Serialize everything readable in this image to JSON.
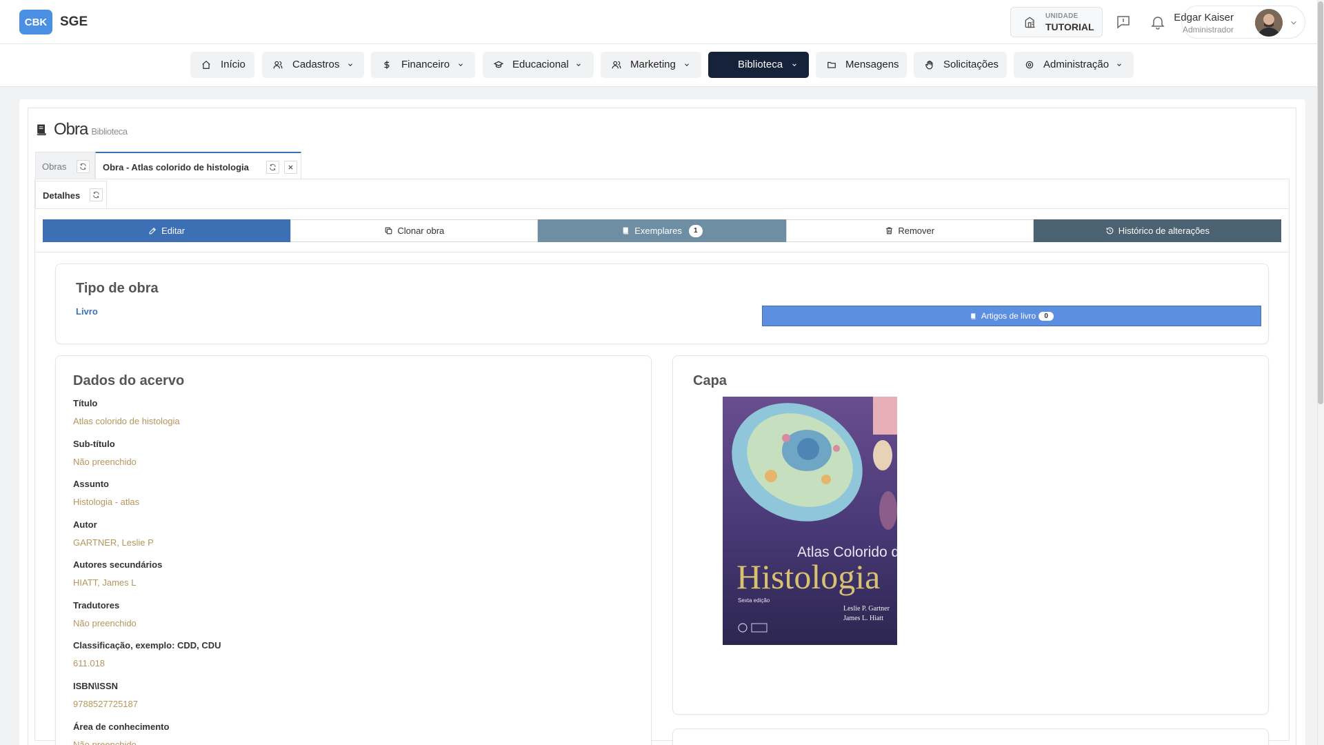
{
  "brand": {
    "logo_text": "CBK",
    "app_name": "SGE"
  },
  "header": {
    "unit_label": "UNIDADE",
    "unit_value": "TUTORIAL",
    "user_name": "Edgar Kaiser",
    "user_role": "Administrador"
  },
  "nav": [
    {
      "label": "Início",
      "icon": "home-icon",
      "dropdown": false
    },
    {
      "label": "Cadastros",
      "icon": "users-icon",
      "dropdown": true
    },
    {
      "label": "Financeiro",
      "icon": "dollar-icon",
      "dropdown": true
    },
    {
      "label": "Educacional",
      "icon": "graduation-cap-icon",
      "dropdown": true
    },
    {
      "label": "Marketing",
      "icon": "users-icon",
      "dropdown": true
    },
    {
      "label": "Biblioteca",
      "icon": "book-icon",
      "dropdown": true,
      "active": true
    },
    {
      "label": "Mensagens",
      "icon": "folder-icon",
      "dropdown": false
    },
    {
      "label": "Solicitações",
      "icon": "hand-icon",
      "dropdown": false
    },
    {
      "label": "Administração",
      "icon": "settings-icon",
      "dropdown": true
    }
  ],
  "page": {
    "title": "Obra",
    "subtitle": "Biblioteca"
  },
  "tabs": [
    {
      "label": "Obras",
      "active": false
    },
    {
      "label": "Obra - Atlas colorido de histologia",
      "active": true
    }
  ],
  "subtab": {
    "label": "Detalhes"
  },
  "actions": {
    "edit": "Editar",
    "clone": "Clonar obra",
    "exemplares": "Exemplares",
    "exemplares_count": "1",
    "remove": "Remover",
    "history": "Histórico de alterações"
  },
  "tipo": {
    "title": "Tipo de obra",
    "value": "Livro",
    "artigos_label": "Artigos de livro",
    "artigos_count": "0"
  },
  "acervo": {
    "title": "Dados do acervo",
    "fields": [
      {
        "label": "Título",
        "value": "Atlas colorido de histologia"
      },
      {
        "label": "Sub-título",
        "value": "Não preenchido"
      },
      {
        "label": "Assunto",
        "value": "Histologia - atlas"
      },
      {
        "label": "Autor",
        "value": "GARTNER, Leslie P"
      },
      {
        "label": "Autores secundários",
        "value": "HIATT, James L"
      },
      {
        "label": "Tradutores",
        "value": "Não preenchido"
      },
      {
        "label": "Classificação, exemplo: CDD, CDU",
        "value": "611.018"
      },
      {
        "label": "ISBN\\ISSN",
        "value": "9788527725187"
      },
      {
        "label": "Área de conhecimento",
        "value": "Não preenchido"
      }
    ]
  },
  "capa": {
    "title": "Capa",
    "cover_line1": "Atlas Colorido de",
    "cover_line2": "Histologia",
    "cover_edition": "Sexta edição",
    "cover_author1": "Leslie P. Gartner",
    "cover_author2": "James L. Hiatt"
  },
  "colors": {
    "primary": "#3d6fb5",
    "nav_active": "#16213a",
    "value_text": "#b5965a",
    "brand_logo": "#4a90e2"
  }
}
